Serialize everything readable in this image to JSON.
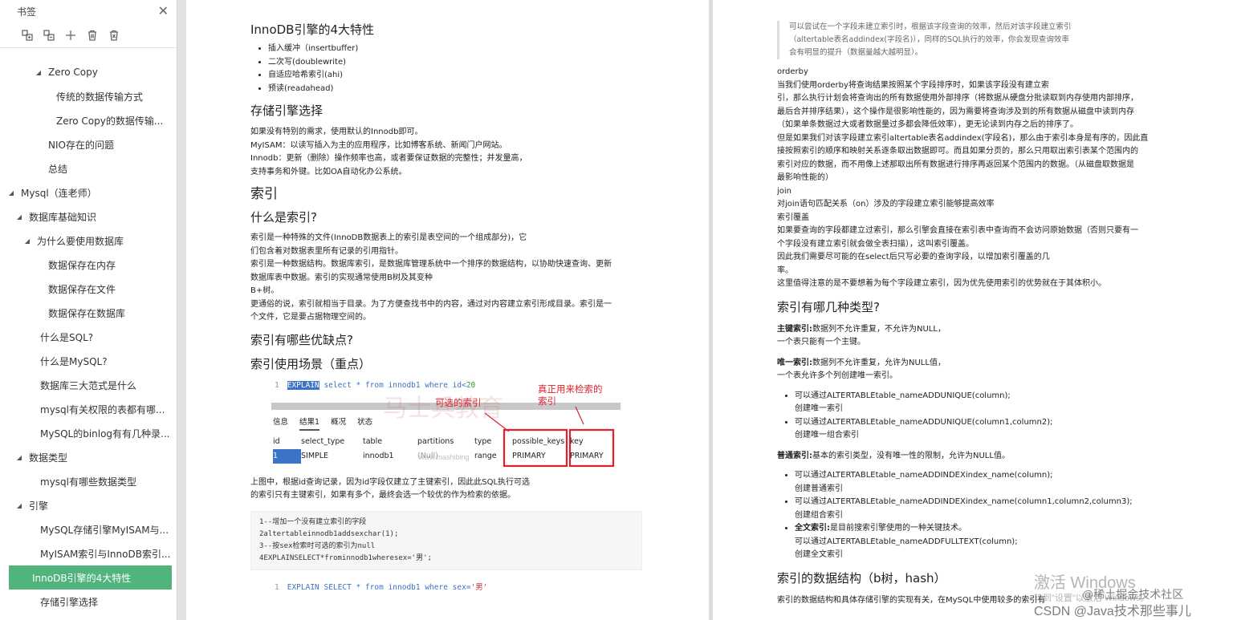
{
  "sidebar": {
    "title": "书签",
    "tools": [
      "expand-all-icon",
      "collapse-all-icon",
      "add-bookmark-icon",
      "delete-icon",
      "delete-all-icon"
    ],
    "items": [
      {
        "label": "Zero Copy",
        "indent": 46,
        "caret": "◢"
      },
      {
        "label": "传统的数据传输方式",
        "indent": 70,
        "caret": ""
      },
      {
        "label": "Zero Copy的数据传输...",
        "indent": 70,
        "caret": ""
      },
      {
        "label": "NIO存在的问题",
        "indent": 60,
        "caret": ""
      },
      {
        "label": "总结",
        "indent": 60,
        "caret": ""
      },
      {
        "label": "Mysql（连老师）",
        "indent": 12,
        "caret": "◢"
      },
      {
        "label": "数据库基础知识",
        "indent": 22,
        "caret": "◢"
      },
      {
        "label": "为什么要使用数据库",
        "indent": 32,
        "caret": "◢"
      },
      {
        "label": "数据保存在内存",
        "indent": 60,
        "caret": ""
      },
      {
        "label": "数据保存在文件",
        "indent": 60,
        "caret": ""
      },
      {
        "label": "数据保存在数据库",
        "indent": 60,
        "caret": ""
      },
      {
        "label": "什么是SQL?",
        "indent": 50,
        "caret": ""
      },
      {
        "label": "什么是MySQL?",
        "indent": 50,
        "caret": ""
      },
      {
        "label": "数据库三大范式是什么",
        "indent": 50,
        "caret": ""
      },
      {
        "label": "mysql有关权限的表都有哪...",
        "indent": 50,
        "caret": ""
      },
      {
        "label": "MySQL的binlog有有几种录...",
        "indent": 50,
        "caret": ""
      },
      {
        "label": "数据类型",
        "indent": 22,
        "caret": "◢"
      },
      {
        "label": "mysql有哪些数据类型",
        "indent": 50,
        "caret": ""
      },
      {
        "label": "引擎",
        "indent": 22,
        "caret": "◢"
      },
      {
        "label": "MySQL存储引擎MyISAM与...",
        "indent": 50,
        "caret": ""
      },
      {
        "label": "MyISAM索引与InnoDB索引...",
        "indent": 50,
        "caret": ""
      },
      {
        "label": "InnoDB引擎的4大特性",
        "indent": 40,
        "caret": "",
        "active": true
      },
      {
        "label": "存储引擎选择",
        "indent": 50,
        "caret": ""
      }
    ]
  },
  "page1": {
    "h_innodb": "InnoDB引擎的4大特性",
    "innodb_list": [
      "插入缓冲（insertbuffer)",
      "二次写(doublewrite)",
      "自适应哈希索引(ahi)",
      "预读(readahead)"
    ],
    "h_engine": "存储引擎选择",
    "engine_p": [
      "如果没有特别的需求，使用默认的Innodb即可。",
      "MyISAM：以读写插入为主的应用程序，比如博客系统、新闻门户网站。",
      "Innodb：更新（删除）操作频率也高，或者要保证数据的完整性；并发量高，",
      "支持事务和外键。比如OA自动化办公系统。"
    ],
    "h_index": "索引",
    "h_whatis": "什么是索引?",
    "whatis_p": [
      "索引是一种特殊的文件(InnoDB数据表上的索引是表空间的一个组成部分)，它",
      "们包含着对数据表里所有记录的引用指针。",
      "索引是一种数据结构。数据库索引，是数据库管理系统中一个排序的数据结构，以协助快速查询、更新",
      "数据库表中数据。索引的实现通常使用B树及其变种",
      "B+树。",
      "更通俗的说，索引就相当于目录。为了方便查找书中的内容，通过对内容建立索引形成目录。索引是一",
      "个文件，它是要占据物理空间的。"
    ],
    "h_pros": "索引有哪些优缺点?",
    "h_scene": "索引使用场景（重点）",
    "fig": {
      "line_no": "1",
      "sql_explain": "EXPLAIN",
      "sql_rest": " select * from innodb1 where id<",
      "sql_num": "20",
      "ann1": "可选的索引",
      "ann2": "真正用来检索的",
      "ann2b": "索引",
      "tabs": [
        "信息",
        "结果1",
        "概况",
        "状态"
      ],
      "headers": [
        "id",
        "select_type",
        "table",
        "partitions",
        "type",
        "possible_keys",
        "key"
      ],
      "row": [
        "1",
        "SIMPLE",
        "innodb1",
        "(Null)",
        "range",
        "PRIMARY",
        "PRIMARY"
      ],
      "watermark": "马士兵教育",
      "watermark2": "www.mashibing"
    },
    "fig_p": [
      "上图中，根据id查询记录，因为id字段仅建立了主键索引，因此此SQL执行可选",
      "的索引只有主键索引，如果有多个，最终会选一个较优的作为检索的依据。"
    ],
    "code": [
      "1--增加一个没有建立索引的字段",
      "2altertableinnodb1addsexchar(1);",
      "3--按sex检索时可选的索引为null",
      "4EXPLAINSELECT*frominnodb1wheresex='男';"
    ],
    "fig2_line": "1",
    "fig2_sql_kw": "EXPLAIN SELECT",
    "fig2_sql_mid": " * from innodb1 where sex=",
    "fig2_sql_str": "'男'"
  },
  "page2": {
    "quote": [
      "可以尝试在一个字段未建立索引时，根据该字段查询的效率，然后对该字段建立索引",
      "（altertable表名addindex(字段名)），同样的SQL执行的效率，你会发现查询效率",
      "会有明显的提升（数据量越大越明显）。"
    ],
    "orderby_p": [
      "orderby",
      "当我们使用orderby将查询结果按照某个字段排序时，如果该字段没有建立索",
      "引，那么执行计划会将查询出的所有数据使用外部排序（将数据从硬盘分批读取到内存使用内部排序，",
      "最后合并排序结果），这个操作是很影响性能的，因为需要将查询涉及到的所有数据从磁盘中读到内存",
      "（如果单条数据过大或者数据量过多都会降低效率），更无论读到内存之后的排序了。",
      "但是如果我们对该字段建立索引altertable表名addindex(字段名)，那么由于索引本身是有序的，因此直",
      "接按照索引的顺序和映射关系逐条取出数据即可。而且如果分页的，那么只用取出索引表某个范围内的",
      "索引对应的数据，而不用像上述那取出所有数据进行排序再返回某个范围内的数据。（从磁盘取数据是",
      "最影响性能的）",
      "join",
      "对join语句匹配关系（on）涉及的字段建立索引能够提高效率",
      "索引覆盖",
      "如果要查询的字段都建立过索引，那么引擎会直接在索引表中查询而不会访问原始数据（否则只要有一",
      "个字段没有建立索引就会做全表扫描），这叫索引覆盖。",
      "因此我们需要尽可能的在select后只写必要的查询字段，以增加索引覆盖的几",
      "率。",
      "这里值得注意的是不要想着为每个字段建立索引，因为优先使用索引的优势就在于其体积小。"
    ],
    "h_types": "索引有哪几种类型?",
    "pk_bold": "主键索引:",
    "pk_text": "数据列不允许重复，不允许为NULL，",
    "pk_text2": "一个表只能有一个主键。",
    "uq_bold": "唯一索引:",
    "uq_text": "数据列不允许重复，允许为NULL值，",
    "uq_text2": "一个表允许多个列创建唯一索引。",
    "uq_list": [
      [
        "可以通过ALTERTABLEtable_nameADDUNIQUE(column);",
        "创建唯一索引"
      ],
      [
        "可以通过ALTERTABLEtable_nameADDUNIQUE(column1,column2);",
        "创建唯一组合索引"
      ]
    ],
    "normal_bold": "普通索引:",
    "normal_text": "基本的索引类型，没有唯一性的限制，允许为NULL值。",
    "normal_list": [
      [
        "可以通过ALTERTABLEtable_nameADDINDEXindex_name(column);",
        "创建普通索引"
      ],
      [
        "可以通过ALTERTABLEtable_nameADDINDEXindex_name(column1,column2,column3);",
        "创建组合索引"
      ]
    ],
    "ft_bold": "全文索引:",
    "ft_text": "是目前搜索引擎使用的一种关键技术。",
    "ft_sub": [
      "可以通过ALTERTABLEtable_nameADDFULLTEXT(column);",
      "创建全文索引"
    ],
    "h_struct": "索引的数据结构（b树，hash）",
    "struct_p": "索引的数据结构和具体存储引擎的实现有关，在MySQL中使用较多的索引有"
  },
  "overlay": {
    "activate": "激活 Windows",
    "activate_sub": "转到\"设置\"以激活 Windows。",
    "juejin": "@稀土掘金技术社区",
    "author": "CSDN @Java技术那些事儿"
  },
  "colors": {
    "accent": "#52b47d",
    "annotation": "#e0202a",
    "sql_kw": "#3b73c6"
  }
}
